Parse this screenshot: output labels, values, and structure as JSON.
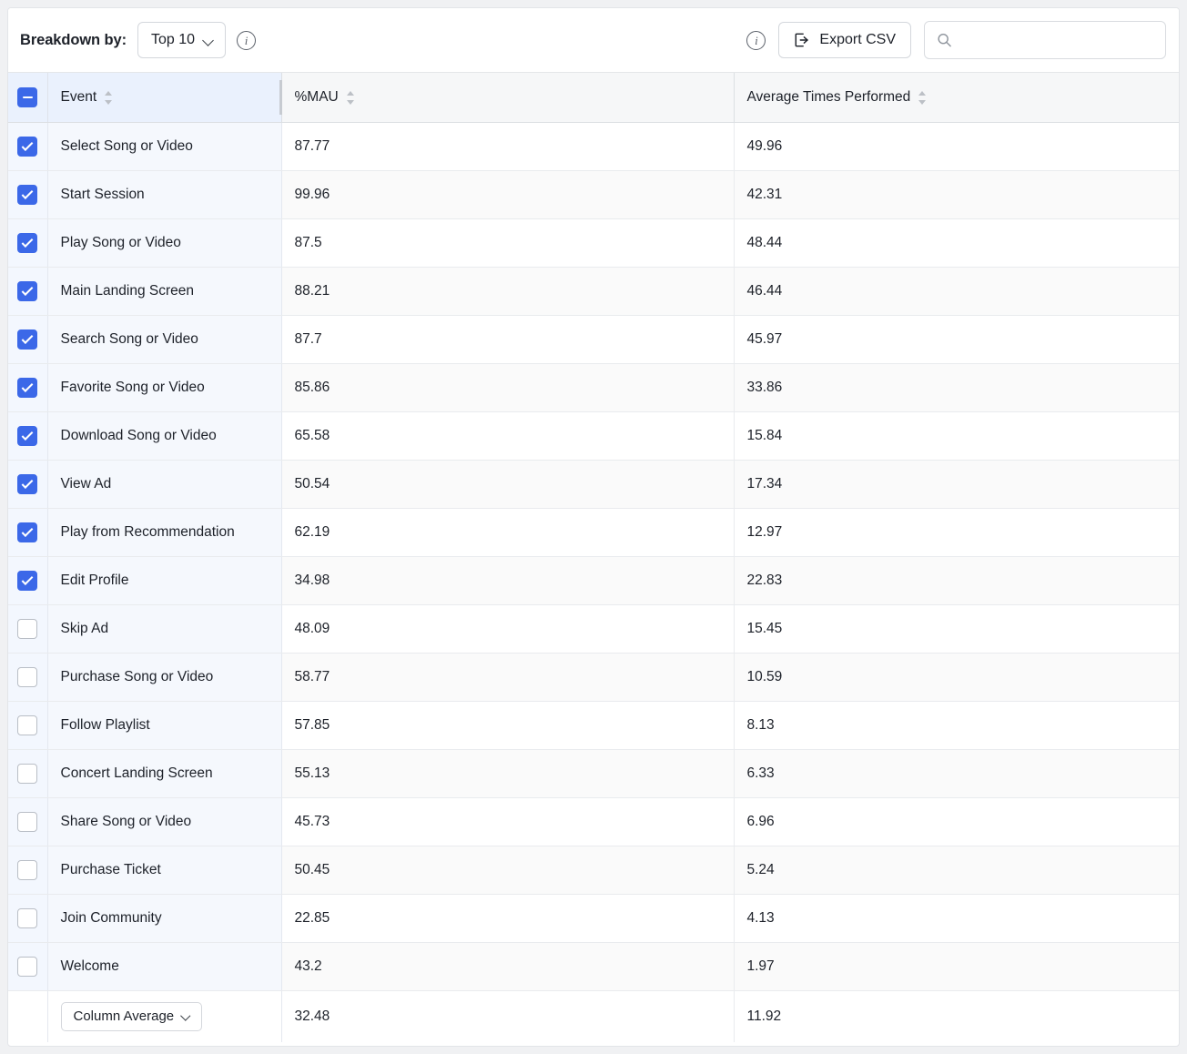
{
  "toolbar": {
    "breakdown_label": "Breakdown by:",
    "breakdown_value": "Top 10",
    "breakdown_info_icon": "info-icon",
    "right_info_icon": "info-icon",
    "export_label": "Export CSV",
    "export_icon": "export-icon",
    "search_icon": "search-icon",
    "search_value": "",
    "search_placeholder": ""
  },
  "table": {
    "header_checkbox_state": "indeterminate",
    "columns": [
      {
        "key": "event",
        "label": "Event",
        "sortable": true
      },
      {
        "key": "mau",
        "label": "%MAU",
        "sortable": true
      },
      {
        "key": "avg",
        "label": "Average Times Performed",
        "sortable": true
      }
    ],
    "rows": [
      {
        "checked": true,
        "event": "Select Song or Video",
        "mau": "87.77",
        "avg": "49.96"
      },
      {
        "checked": true,
        "event": "Start Session",
        "mau": "99.96",
        "avg": "42.31"
      },
      {
        "checked": true,
        "event": "Play Song or Video",
        "mau": "87.5",
        "avg": "48.44"
      },
      {
        "checked": true,
        "event": "Main Landing Screen",
        "mau": "88.21",
        "avg": "46.44"
      },
      {
        "checked": true,
        "event": "Search Song or Video",
        "mau": "87.7",
        "avg": "45.97"
      },
      {
        "checked": true,
        "event": "Favorite Song or Video",
        "mau": "85.86",
        "avg": "33.86"
      },
      {
        "checked": true,
        "event": "Download Song or Video",
        "mau": "65.58",
        "avg": "15.84"
      },
      {
        "checked": true,
        "event": "View Ad",
        "mau": "50.54",
        "avg": "17.34"
      },
      {
        "checked": true,
        "event": "Play from Recommendation",
        "mau": "62.19",
        "avg": "12.97"
      },
      {
        "checked": true,
        "event": "Edit Profile",
        "mau": "34.98",
        "avg": "22.83"
      },
      {
        "checked": false,
        "event": "Skip Ad",
        "mau": "48.09",
        "avg": "15.45"
      },
      {
        "checked": false,
        "event": "Purchase Song or Video",
        "mau": "58.77",
        "avg": "10.59"
      },
      {
        "checked": false,
        "event": "Follow Playlist",
        "mau": "57.85",
        "avg": "8.13"
      },
      {
        "checked": false,
        "event": "Concert Landing Screen",
        "mau": "55.13",
        "avg": "6.33"
      },
      {
        "checked": false,
        "event": "Share Song or Video",
        "mau": "45.73",
        "avg": "6.96"
      },
      {
        "checked": false,
        "event": "Purchase Ticket",
        "mau": "50.45",
        "avg": "5.24"
      },
      {
        "checked": false,
        "event": "Join Community",
        "mau": "22.85",
        "avg": "4.13"
      },
      {
        "checked": false,
        "event": "Welcome",
        "mau": "43.2",
        "avg": "1.97"
      }
    ],
    "footer": {
      "aggregate_label": "Column Average",
      "mau": "32.48",
      "avg": "11.92"
    }
  },
  "colors": {
    "accent": "#3b68e8",
    "event_column_tint": "#f5f8fd",
    "header_tint": "#eaf1fd",
    "header_gray": "#f6f7f8"
  }
}
